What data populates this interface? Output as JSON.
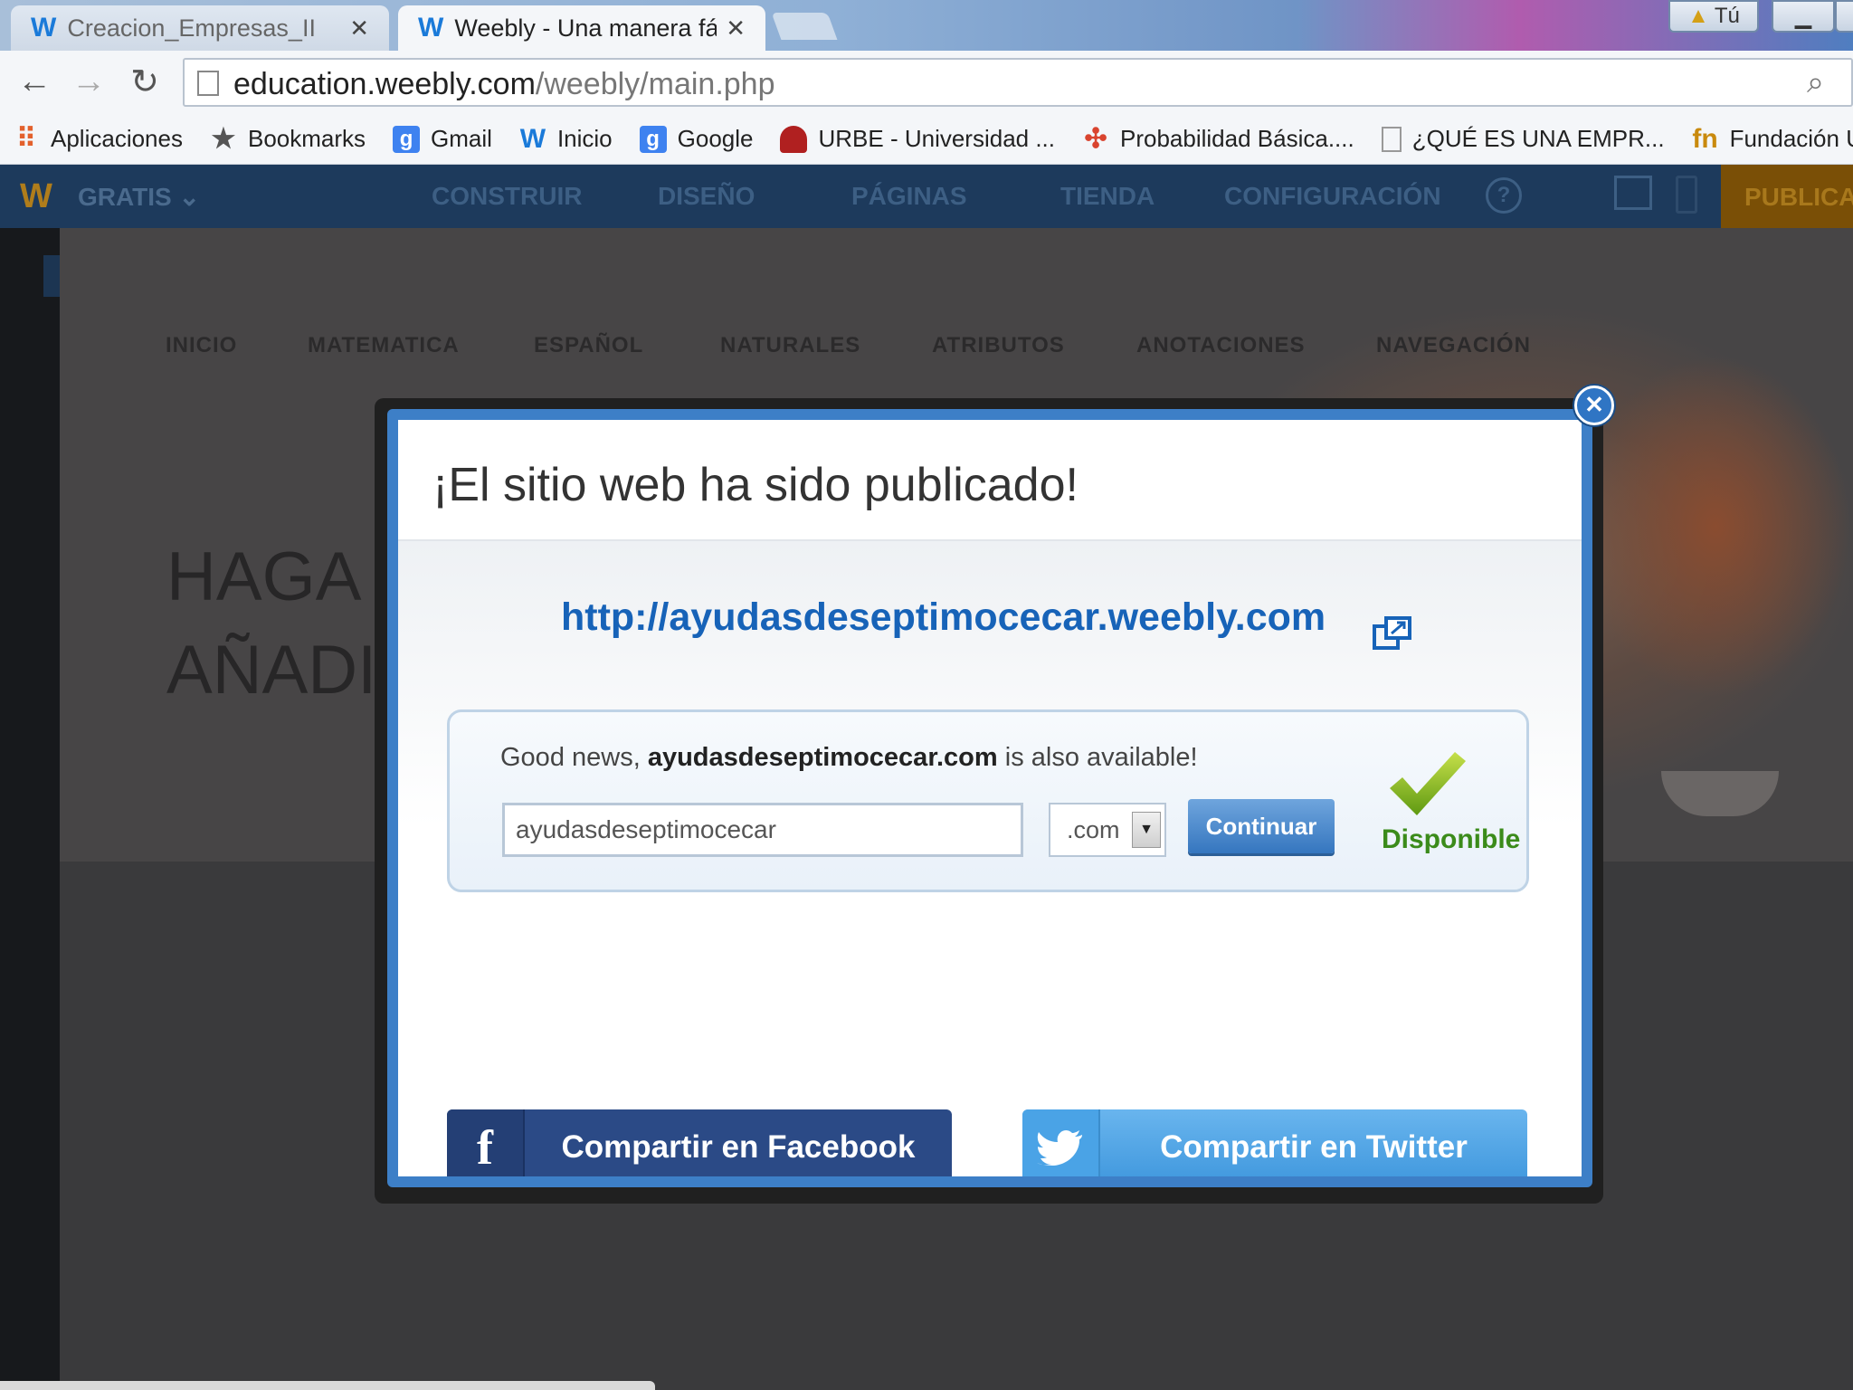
{
  "browser": {
    "tabs": [
      {
        "title": "Creacion_Empresas_II",
        "active": false,
        "icon": "weebly-icon"
      },
      {
        "title": "Weebly - Una manera fác",
        "active": true,
        "icon": "weebly-icon"
      }
    ],
    "window_buttons": {
      "user_label": "Tú"
    },
    "url_host": "education.weebly.com",
    "url_path": "/weebly/main.php",
    "bookmarks": [
      {
        "label": "Aplicaciones",
        "icon": "apps-grid-icon"
      },
      {
        "label": "Bookmarks",
        "icon": "star-icon"
      },
      {
        "label": "Gmail",
        "icon": "google-icon"
      },
      {
        "label": "Inicio",
        "icon": "weebly-icon"
      },
      {
        "label": "Google",
        "icon": "google-icon"
      },
      {
        "label": "URBE - Universidad ...",
        "icon": "urbe-icon"
      },
      {
        "label": "Probabilidad Básica....",
        "icon": "pinwheel-icon"
      },
      {
        "label": "¿QUÉ ES UNA EMPR...",
        "icon": "page-icon"
      },
      {
        "label": "Fundación Univer",
        "icon": "fundacion-icon"
      }
    ]
  },
  "editor": {
    "plan": "GRATIS ⌄",
    "tabs": [
      "CONSTRUIR",
      "DISEÑO",
      "PÁGINAS",
      "TIENDA",
      "CONFIGURACIÓN"
    ],
    "help": "?",
    "publish": "PUBLICA"
  },
  "site": {
    "nav": [
      "INICIO",
      "MATEMATICA",
      "ESPAÑOL",
      "NATURALES",
      "ATRIBUTOS",
      "ANOTACIONES",
      "NAVEGACIÓN"
    ],
    "hero_line1": "HAGA C",
    "hero_line2": "AÑADI"
  },
  "modal": {
    "title": "¡El sitio web ha sido publicado!",
    "site_url": "http://ayudasdeseptimocecar.weebly.com",
    "good_news_prefix": "Good news, ",
    "good_news_domain": "ayudasdeseptimocecar.com",
    "good_news_suffix": " is also available!",
    "domain_input_value": "ayudasdeseptimocecar",
    "tld_value": ".com",
    "continue_label": "Continuar",
    "available_label": "Disponible",
    "facebook_label": "Compartir en Facebook",
    "twitter_label": "Compartir en Twitter",
    "colors": {
      "accent": "#3d7fc7",
      "link": "#1763b8",
      "available": "#3b8b1a",
      "facebook": "#2b4a86",
      "twitter": "#4aa3e6"
    }
  }
}
